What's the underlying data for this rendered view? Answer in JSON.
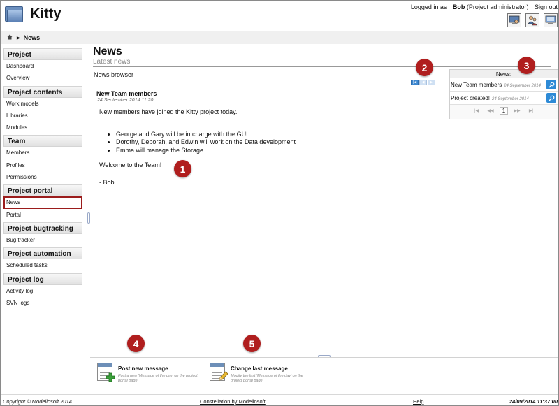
{
  "app": {
    "title": "Kitty"
  },
  "header": {
    "logged_in_prefix": "Logged in as",
    "user": "Bob",
    "role": "(Project administrator)",
    "signout": "Sign out",
    "icons": [
      "monitor-user-icon",
      "users-icon",
      "computer-icon"
    ]
  },
  "breadcrumb": {
    "home_icon": "home-icon",
    "current": "News"
  },
  "sidebar": {
    "sections": [
      {
        "title": "Project",
        "items": [
          "Dashboard",
          "Overview"
        ]
      },
      {
        "title": "Project contents",
        "items": [
          "Work models",
          "Libraries",
          "Modules"
        ]
      },
      {
        "title": "Team",
        "items": [
          "Members",
          "Profiles",
          "Permissions"
        ]
      },
      {
        "title": "Project portal",
        "items": [
          "News",
          "Portal"
        ]
      },
      {
        "title": "Project bugtracking",
        "items": [
          "Bug tracker"
        ]
      },
      {
        "title": "Project automation",
        "items": [
          "Scheduled tasks"
        ]
      },
      {
        "title": "Project log",
        "items": [
          "Activity log",
          "SVN logs"
        ]
      }
    ],
    "active_item": "News"
  },
  "main": {
    "title": "News",
    "subtitle": "Latest news",
    "browser_label": "News browser",
    "news": {
      "title": "New Team members",
      "date": "24 September 2014 11:20",
      "intro": "New members have joined the Kitty project today.",
      "bullets": [
        "George and Gary will be in charge with the GUI",
        "Dorothy, Deborah, and Edwin will work on the Data development",
        "Emma will manage the Storage"
      ],
      "closing": "Welcome to the Team!",
      "signature": "- Bob"
    }
  },
  "markers": [
    "1",
    "2",
    "3",
    "4",
    "5"
  ],
  "pager_top": {
    "icons": [
      "first-page-icon",
      "prev-page-icon",
      "next-page-icon"
    ]
  },
  "right_panel": {
    "header": "News:",
    "rows": [
      {
        "title": "New Team members",
        "date": "24 September 2014"
      },
      {
        "title": "Project created!",
        "date": "24 September 2014"
      }
    ],
    "pager": {
      "first": "|◀",
      "prev": "◀◀",
      "current": "1",
      "next": "▶▶",
      "last": "▶|"
    }
  },
  "actions": [
    {
      "title": "Post new message",
      "desc": "Post a new 'Message of the day' on the project portal page",
      "icon": "news-add-icon"
    },
    {
      "title": "Change last message",
      "desc": "Modify the last 'Message of the day' on the project portal page",
      "icon": "news-edit-icon"
    }
  ],
  "footer": {
    "copyright": "Copyright © Modeliosoft 2014",
    "link": "Constellation by Modeliosoft",
    "help": "Help",
    "datetime": "24/09/2014 11:37:00"
  },
  "colors": {
    "marker": "#b01e1e",
    "active_border": "#9b1c1c",
    "accent_blue": "#2d8ad6"
  }
}
